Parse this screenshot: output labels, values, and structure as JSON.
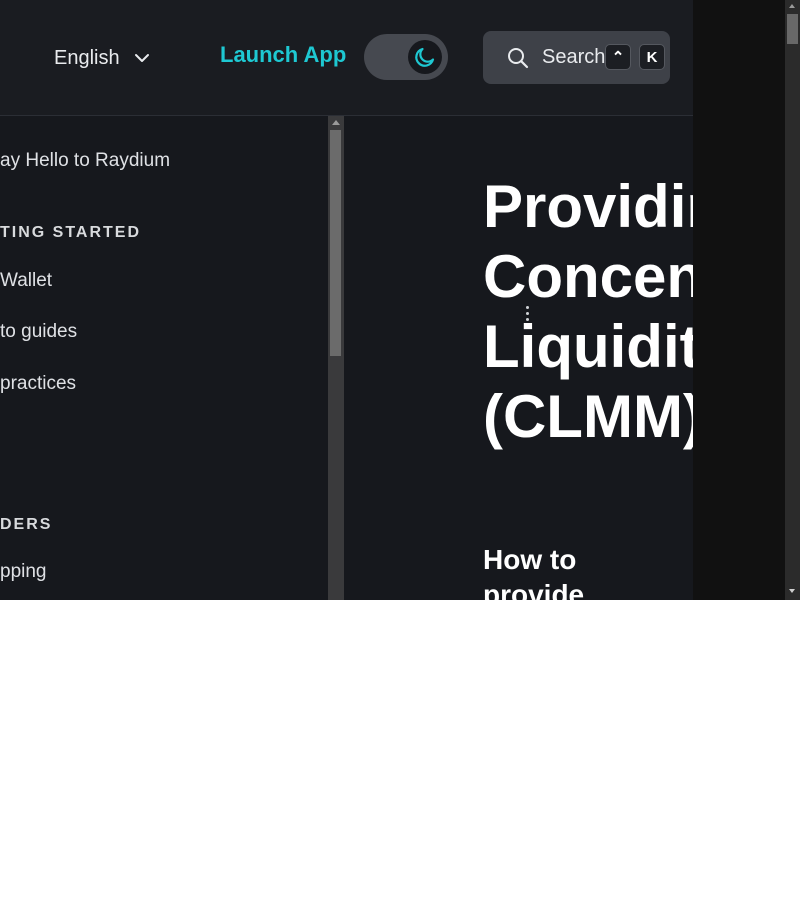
{
  "header": {
    "language": "English",
    "launch_label": "Launch App",
    "theme": "dark",
    "search_label": "Search",
    "shortcut_modifier": "⌃",
    "shortcut_key": "K",
    "accent": "#1ec8d2"
  },
  "sidebar": {
    "items": [
      {
        "label": "ay Hello to Raydium"
      },
      {
        "category": "TING STARTED"
      },
      {
        "label": "Wallet"
      },
      {
        "label": "to guides"
      },
      {
        "label": "practices"
      },
      {
        "category": "DERS"
      },
      {
        "label": "pping"
      }
    ]
  },
  "main": {
    "title_lines": [
      "Providin",
      "Concent",
      "Liquidity",
      "(CLMM)"
    ],
    "subheading": "How to provide"
  },
  "icons": {
    "language_chevron": "chevron-down-icon",
    "theme": "moon-icon",
    "search": "search-icon"
  }
}
